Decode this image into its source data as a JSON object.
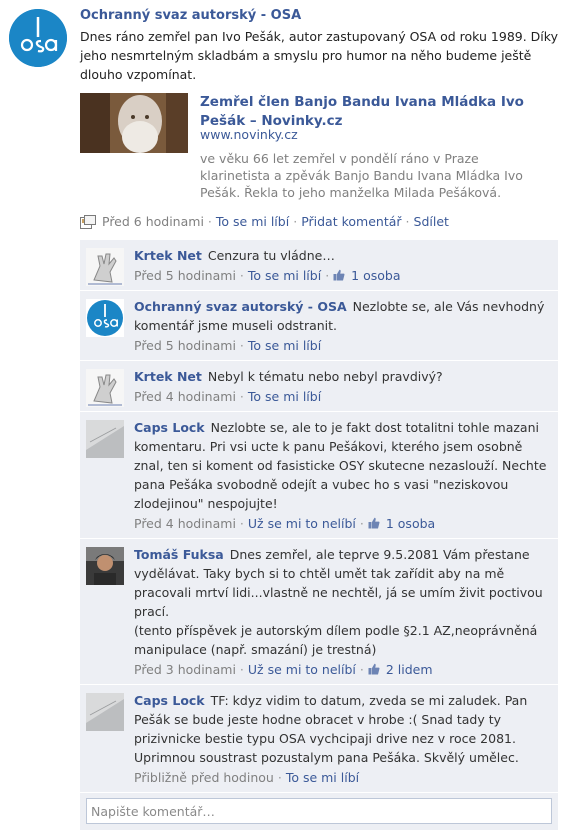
{
  "post": {
    "author": "Ochranný svaz autorský - OSA",
    "text": "Dnes ráno zemřel pan Ivo Pešák, autor zastupovaný OSA od roku 1989. Díky jeho nesmrtelným skladbám a smyslu pro humor na něho budeme ještě dlouho vzpomínat.",
    "share": {
      "title": "Zemřel člen Banjo Bandu Ivana Mládka Ivo Pešák – Novinky.cz",
      "url": "www.novinky.cz",
      "description": "ve věku 66 let zemřel v pondělí ráno v Praze klarinetista a zpěvák Banjo Bandu Ivana Mládka Ivo Pešák. Řekla to jeho manželka Milada Pešáková."
    },
    "actions": {
      "time": "Před 6 hodinami",
      "like": "To se mi líbí",
      "comment": "Přidat komentář",
      "share": "Sdílet",
      "separator": "·"
    }
  },
  "comments": [
    {
      "author": "Krtek Net",
      "text": "Cenzura tu vládne…",
      "time": "Před 5 hodinami",
      "like": "To se mi líbí",
      "likes": "1 osoba",
      "avatar": "hand-icon"
    },
    {
      "author": "Ochranný svaz autorský - OSA",
      "text": "Nezlobte se, ale Vás nevhodný komentář jsme museli odstranit.",
      "time": "Před 5 hodinami",
      "like": "To se mi líbí",
      "likes": "",
      "avatar": "osa-logo"
    },
    {
      "author": "Krtek Net",
      "text": "Nebyl k tématu nebo nebyl pravdivý?",
      "time": "Před 4 hodinami",
      "like": "To se mi líbí",
      "likes": "",
      "avatar": "hand-icon"
    },
    {
      "author": "Caps Lock",
      "text": "Nezlobte se, ale to je fakt dost totalitni tohle mazani komentaru. Pri vsi ucte k panu Pešákovi, kterého jsem osobně znal, ten si koment od fasisticke OSY skutecne nezaslouží. Nechte pana Pešáka svobodně odejít a vubec ho s vasi \"neziskovou zlodejinou\" nespojujte!",
      "time": "Před 4 hodinami",
      "like": "Už se mi to nelíbí",
      "likes": "1 osoba",
      "avatar": "keyboard-photo"
    },
    {
      "author": "Tomáš Fuksa",
      "text": "Dnes zemřel, ale teprve 9.5.2081 Vám přestane vydělávat. Taky bych si to chtěl umět tak zařídit aby na mě pracovali mrtví lidi...vlastně ne nechtěl, já se umím živit poctivou prací.\n(tento příspěvek je autorským dílem podle §2.1 AZ,neoprávněná manipulace (např. smazání) je trestná)",
      "time": "Před 3 hodinami",
      "like": "Už se mi to nelíbí",
      "likes": "2 lidem",
      "avatar": "person-photo"
    },
    {
      "author": "Caps Lock",
      "text": "TF: kdyz vidim to datum, zveda se mi zaludek. Pan Pešák se bude jeste hodne obracet v hrobe :( Snad tady ty prizivnicke bestie typu OSA vychcipaji drive nez v roce 2081. Uprimnou soustrast pozustalym pana Pešáka. Skvělý umělec.",
      "time": "Přibližně před hodinou",
      "like": "To se mi líbí",
      "likes": "",
      "avatar": "keyboard-photo"
    }
  ],
  "comment_input": {
    "placeholder": "Napište komentář…"
  },
  "colors": {
    "link": "#3b5998",
    "comment_bg": "#edeff4",
    "osa_blue": "#1b86c6"
  }
}
